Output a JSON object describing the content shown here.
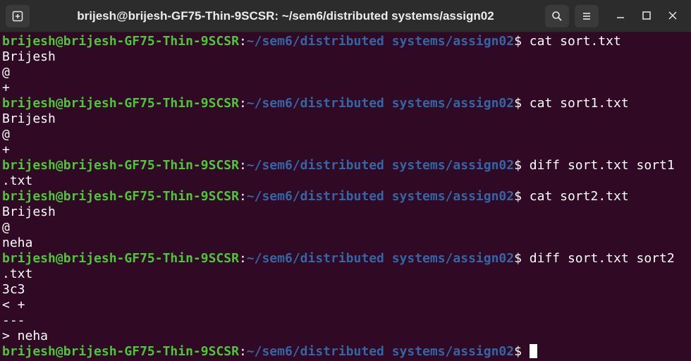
{
  "window": {
    "title": "brijesh@brijesh-GF75-Thin-9SCSR: ~/sem6/distributed systems/assign02"
  },
  "terminal": {
    "user_host": "brijesh@brijesh-GF75-Thin-9SCSR",
    "sep": ":",
    "path": "~/sem6/distributed systems/assign02",
    "dollar": "$ ",
    "commands": [
      "cat sort.txt",
      "cat sort1.txt",
      "diff sort.txt sort1",
      "cat sort2.txt",
      "diff sort.txt sort2"
    ],
    "output": [
      "Brijesh",
      "@",
      "+",
      "Brijesh",
      "@",
      "+",
      ".txt",
      "Brijesh",
      "@",
      "neha",
      ".txt",
      "3c3",
      "< +",
      "---",
      "> neha"
    ]
  },
  "colors": {
    "background": "#300a24",
    "prompt_user": "#4ec63a",
    "prompt_path": "#3465a4",
    "text": "#ffffff",
    "titlebar": "#2c2c2c"
  },
  "icons": {
    "new_tab": "new-tab-icon",
    "search": "search-icon",
    "menu": "hamburger-menu-icon",
    "minimize": "minimize-icon",
    "maximize": "maximize-icon",
    "close": "close-icon"
  }
}
